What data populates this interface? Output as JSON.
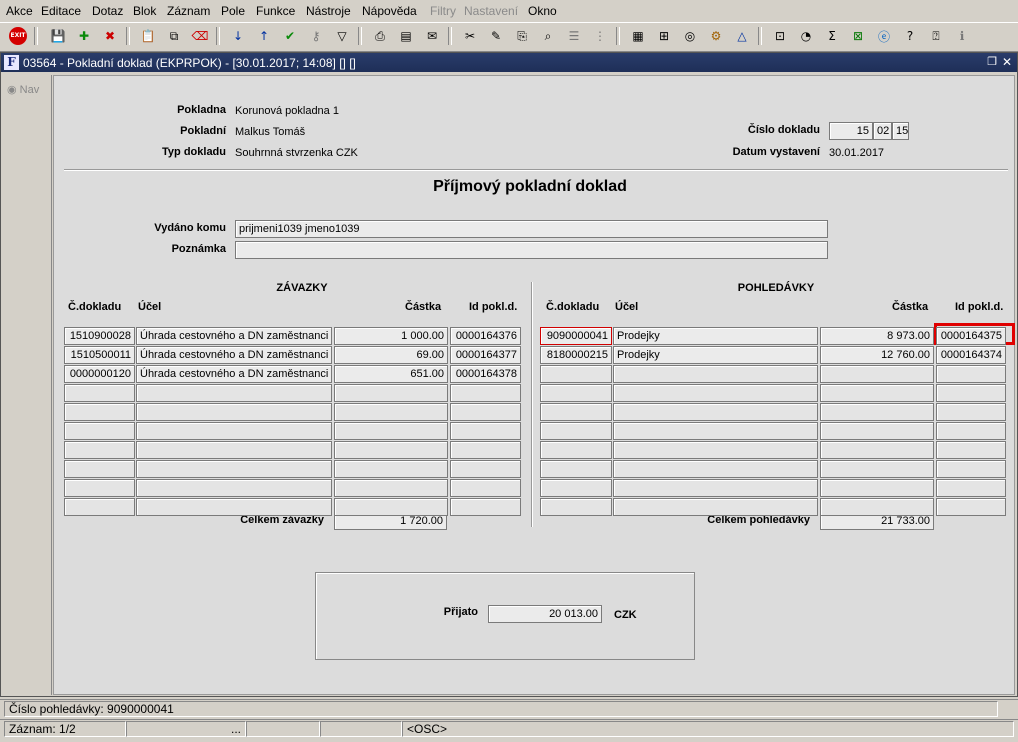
{
  "menu": [
    "Akce",
    "Editace",
    "Dotaz",
    "Blok",
    "Záznam",
    "Pole",
    "Funkce",
    "Nástroje",
    "Nápověda",
    "Filtry",
    "Nastavení",
    "Okno"
  ],
  "menu_disabled": [
    "Filtry",
    "Nastavení"
  ],
  "window": {
    "title": "03564 - Pokladní doklad (EKPRPOK) - [30.01.2017; 14:08] [] []",
    "nav_label": "Nav"
  },
  "header": {
    "pokladna_label": "Pokladna",
    "pokladna_value": "Korunová pokladna 1",
    "pokladni_label": "Pokladní",
    "pokladni_value": "Malkus Tomáš",
    "typ_label": "Typ dokladu",
    "typ_value": "Souhrnná stvrzenka CZK",
    "cislo_label": "Číslo dokladu",
    "cislo_parts": [
      "15",
      "02",
      "15"
    ],
    "datum_label": "Datum vystavení",
    "datum_value": "30.01.2017"
  },
  "form_title": "Příjmový pokladní doklad",
  "vydano_label": "Vydáno komu",
  "vydano_value": "prijmeni1039 jmeno1039",
  "poznamka_label": "Poznámka",
  "poznamka_value": "",
  "zavazky": {
    "title": "ZÁVAZKY",
    "columns": [
      "Č.dokladu",
      "Účel",
      "Částka",
      "Id pokl.d."
    ],
    "rows": [
      [
        "1510900028",
        "Úhrada cestovného a DN zaměstnanci",
        "1 000.00",
        "0000164376"
      ],
      [
        "1510500011",
        "Úhrada cestovného a DN zaměstnanci",
        "69.00",
        "0000164377"
      ],
      [
        "0000000120",
        "Úhrada cestovného a DN zaměstnanci",
        "651.00",
        "0000164378"
      ],
      [
        "",
        "",
        "",
        ""
      ],
      [
        "",
        "",
        "",
        ""
      ],
      [
        "",
        "",
        "",
        ""
      ],
      [
        "",
        "",
        "",
        ""
      ],
      [
        "",
        "",
        "",
        ""
      ],
      [
        "",
        "",
        "",
        ""
      ],
      [
        "",
        "",
        "",
        ""
      ]
    ],
    "total_label": "Celkem závazky",
    "total_value": "1 720.00"
  },
  "pohledavky": {
    "title": "POHLEDÁVKY",
    "columns": [
      "Č.dokladu",
      "Účel",
      "Částka",
      "Id pokl.d."
    ],
    "rows": [
      [
        "9090000041",
        "Prodejky",
        "8 973.00",
        "0000164375"
      ],
      [
        "8180000215",
        "Prodejky",
        "12 760.00",
        "0000164374"
      ],
      [
        "",
        "",
        "",
        ""
      ],
      [
        "",
        "",
        "",
        ""
      ],
      [
        "",
        "",
        "",
        ""
      ],
      [
        "",
        "",
        "",
        ""
      ],
      [
        "",
        "",
        "",
        ""
      ],
      [
        "",
        "",
        "",
        ""
      ],
      [
        "",
        "",
        "",
        ""
      ],
      [
        "",
        "",
        "",
        ""
      ]
    ],
    "total_label": "Celkem pohledávky",
    "total_value": "21 733.00"
  },
  "prijato": {
    "label": "Přijato",
    "value": "20 013.00",
    "currency": "CZK"
  },
  "status": {
    "message": "Číslo pohledávky: 9090000041",
    "record": "Záznam: 1/2",
    "ellipsis": "...",
    "mode": "<OSC>"
  },
  "toolbar_icons": [
    "exit-icon",
    "save-icon",
    "insert-record-icon",
    "delete-record-icon",
    "copy-icon",
    "duplicate-icon",
    "clear-icon",
    "sort-asc-icon",
    "sort-desc-icon",
    "confirm-icon",
    "key-icon",
    "filter-icon",
    "print-icon",
    "print-preview-icon",
    "mail-icon",
    "cut-icon",
    "edit-icon",
    "attach-icon",
    "search-icon",
    "list-icon",
    "tree-icon",
    "calc-icon",
    "grid-icon",
    "globe-icon",
    "gear-icon",
    "triangle-icon",
    "options-icon",
    "chart-icon",
    "sum-icon",
    "excel-icon",
    "ie-icon",
    "help-icon",
    "help-context-icon",
    "info-icon"
  ]
}
